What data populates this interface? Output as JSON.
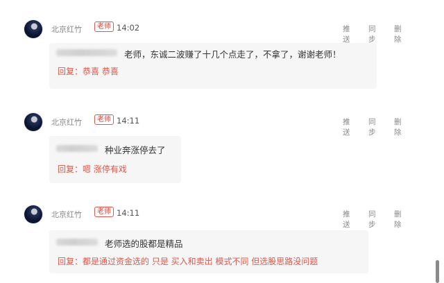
{
  "posts": [
    {
      "author": "北京红竹",
      "badge": "老师",
      "time": "14:02",
      "actions": [
        "推送",
        "同步",
        "删除"
      ],
      "question": "老师，东诚二波赚了十几个点走了，不拿了，谢谢老师！",
      "reply": "回复：恭喜 恭喜"
    },
    {
      "author": "北京红竹",
      "badge": "老师",
      "time": "14:11",
      "actions": [
        "推送",
        "同步",
        "删除"
      ],
      "question": "种业奔涨停去了",
      "reply": "回复：嗯 涨停有戏"
    },
    {
      "author": "北京红竹",
      "badge": "老师",
      "time": "14:11",
      "actions": [
        "推送",
        "同步",
        "删除"
      ],
      "question": "老师选的股都是精品",
      "reply": "回复：都是通过资金选的 只是 买入和卖出 模式不同 但选股思路没问题"
    }
  ]
}
